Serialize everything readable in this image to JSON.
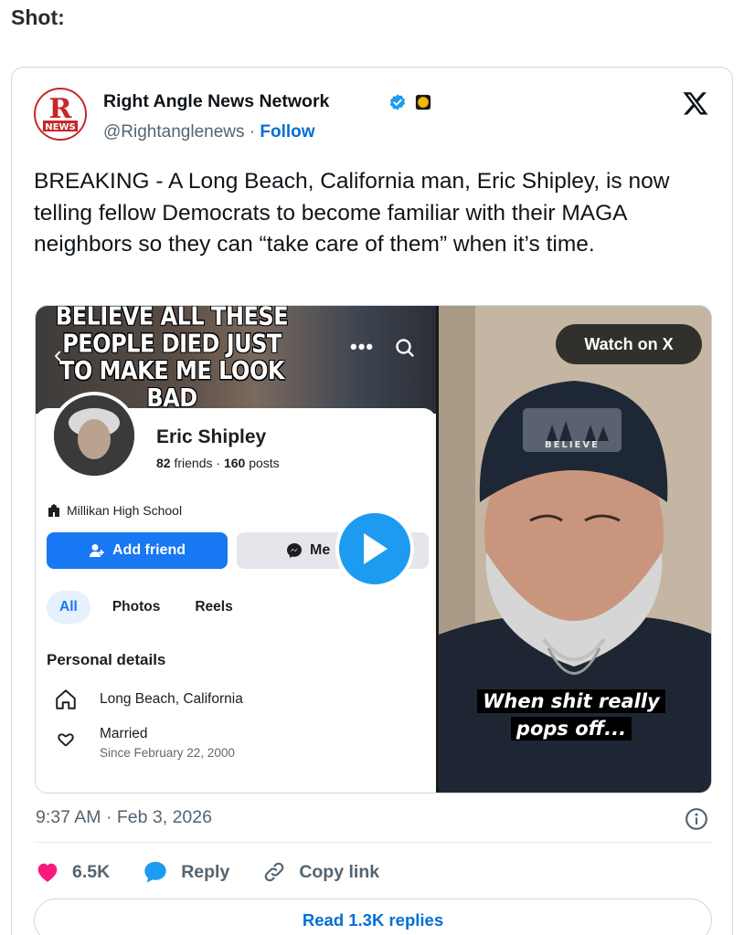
{
  "page_label": "Shot:",
  "author": {
    "name": "Right Angle News Network",
    "handle": "@Rightanglenews",
    "separator": "·",
    "follow_label": "Follow",
    "logo_letter": "R",
    "logo_word": "NEWS"
  },
  "tweet": {
    "text": "BREAKING - A Long Beach, California man, Eric Shipley, is now telling fellow Democrats to become familiar with their MAGA neighbors so they can “take care of them” when it’s time.",
    "timestamp": "9:37 AM · Feb 3, 2026"
  },
  "media": {
    "meme_text": "BELIEVE ALL THESE\nPEOPLE DIED JUST\nTO MAKE ME LOOK BAD",
    "profile": {
      "name": "Eric Shipley",
      "friends": "82",
      "friends_label": "friends",
      "posts": "160",
      "posts_label": "posts",
      "school": "Millikan High School",
      "add_friend_label": "Add friend",
      "message_label": "Me",
      "tabs": [
        "All",
        "Photos",
        "Reels"
      ],
      "section_title": "Personal details",
      "location": "Long Beach, California",
      "relationship": "Married",
      "relationship_since": "Since February 22, 2000"
    },
    "watch_label": "Watch on X",
    "beanie_text": "BELIEVE",
    "caption_line1": "When shit really",
    "caption_line2": "pops off..."
  },
  "actions": {
    "likes": "6.5K",
    "reply_label": "Reply",
    "copy_label": "Copy link",
    "read_replies_label": "Read 1.3K replies"
  },
  "colors": {
    "accent": "#006fd6",
    "like": "#f91880",
    "reply": "#1d9bf0",
    "fb_blue": "#1877f2"
  }
}
